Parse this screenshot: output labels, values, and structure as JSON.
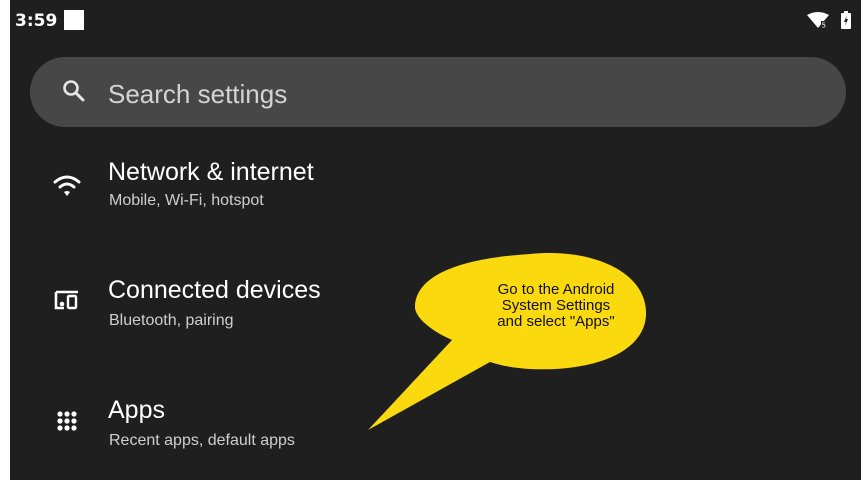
{
  "status_bar": {
    "time": "3:59",
    "icons": [
      "notification-square",
      "wifi-signal-icon",
      "battery-charging-icon"
    ]
  },
  "search": {
    "placeholder": "Search settings",
    "icon": "search-icon"
  },
  "settings_items": [
    {
      "icon": "wifi-icon",
      "title": "Network & internet",
      "subtitle": "Mobile, Wi-Fi, hotspot"
    },
    {
      "icon": "connected-devices-icon",
      "title": "Connected devices",
      "subtitle": "Bluetooth, pairing"
    },
    {
      "icon": "apps-grid-icon",
      "title": "Apps",
      "subtitle": "Recent apps, default apps"
    }
  ],
  "callout": {
    "line1": "Go to the Android",
    "line2": "System Settings",
    "line3": "and select \"Apps\"",
    "color": "#fbd90f"
  },
  "colors": {
    "background": "#1f1f1f",
    "search_bar": "#474747",
    "text_primary": "#ffffff",
    "text_secondary": "#cfcfcf"
  }
}
